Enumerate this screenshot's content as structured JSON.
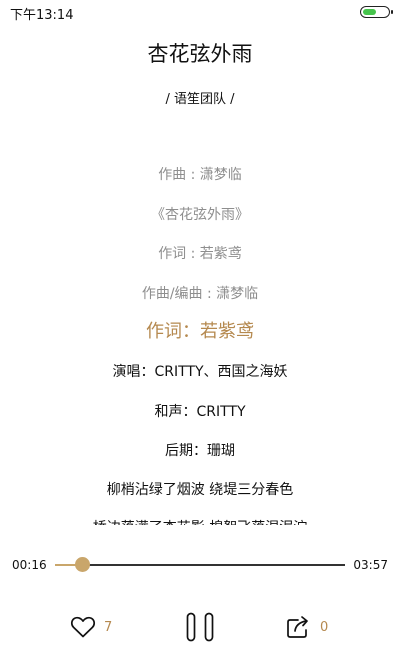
{
  "status_bar": {
    "time": "下午13:14",
    "battery_color": "#46c44c"
  },
  "player": {
    "title": "杏花弦外雨",
    "artist_line": "/  语笙团队  /"
  },
  "lyrics": [
    {
      "text": "作曲 : 潇梦临",
      "style": "dim"
    },
    {
      "text": "《杏花弦外雨》",
      "style": "dim"
    },
    {
      "text": "作词 : 若紫鸢",
      "style": "dim"
    },
    {
      "text": "作曲/编曲 : 潇梦临",
      "style": "dim"
    },
    {
      "text": "作词：若紫鸢",
      "style": "current"
    },
    {
      "text": "演唱：CRITTY、西国之海妖",
      "style": "dark"
    },
    {
      "text": "和声：CRITTY",
      "style": "dark"
    },
    {
      "text": "后期：珊瑚",
      "style": "dark"
    },
    {
      "text": "柳梢沾绿了烟波 绕堤三分春色",
      "style": "dark"
    },
    {
      "text": "桥边落满了杏花影 棉絮飞落湿泥泞",
      "style": "dark"
    }
  ],
  "progress": {
    "elapsed": "00:16",
    "total": "03:57",
    "fraction": 0.092,
    "accent_color": "#c9a66b"
  },
  "controls": {
    "like_icon": "heart-outline-icon",
    "like_count": "7",
    "pause_icon": "pause-icon",
    "share_icon": "share-icon",
    "share_count": "0",
    "accent_color": "#b5894f"
  }
}
